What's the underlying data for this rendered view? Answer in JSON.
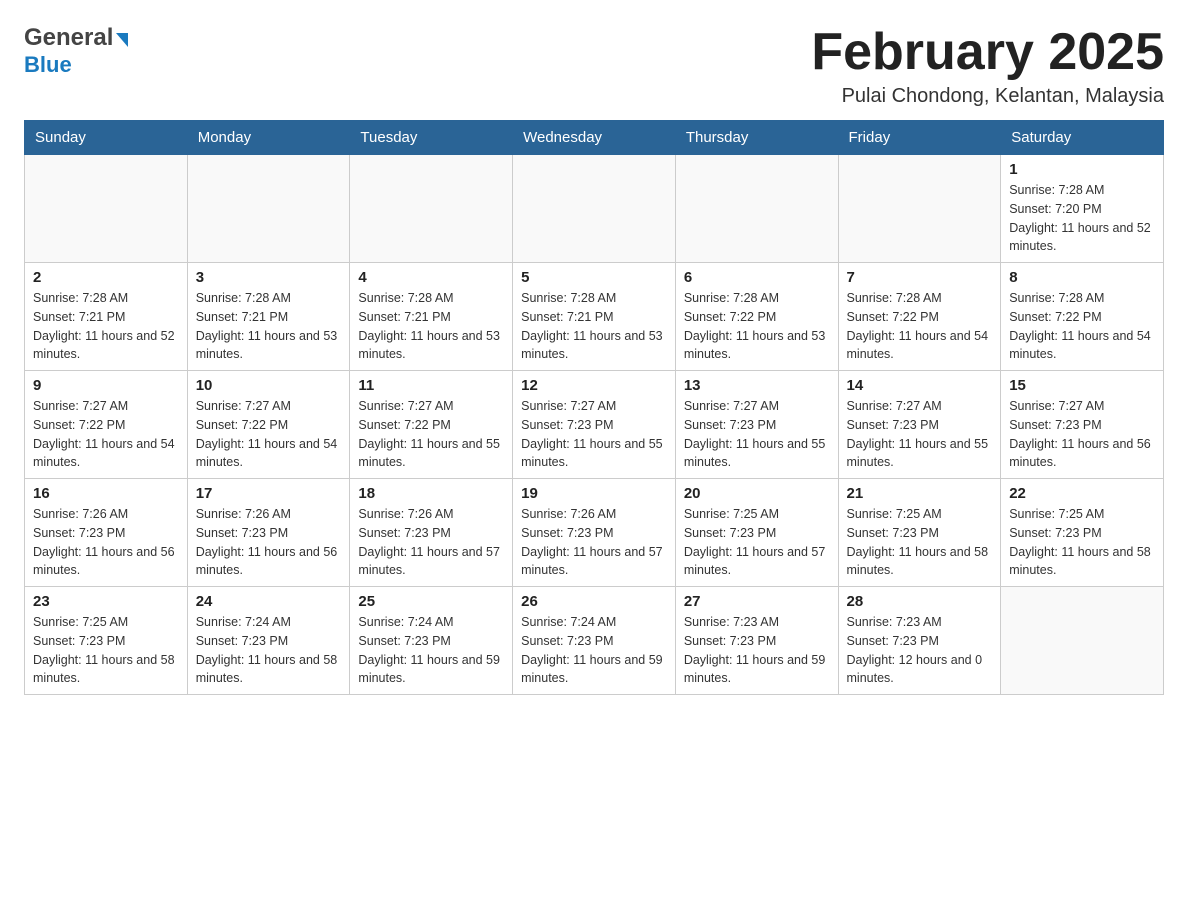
{
  "header": {
    "logo": {
      "part1": "General",
      "arrow": "▶",
      "part2": "Blue"
    },
    "title": "February 2025",
    "subtitle": "Pulai Chondong, Kelantan, Malaysia"
  },
  "weekdays": [
    "Sunday",
    "Monday",
    "Tuesday",
    "Wednesday",
    "Thursday",
    "Friday",
    "Saturday"
  ],
  "weeks": [
    [
      {
        "day": "",
        "info": ""
      },
      {
        "day": "",
        "info": ""
      },
      {
        "day": "",
        "info": ""
      },
      {
        "day": "",
        "info": ""
      },
      {
        "day": "",
        "info": ""
      },
      {
        "day": "",
        "info": ""
      },
      {
        "day": "1",
        "info": "Sunrise: 7:28 AM\nSunset: 7:20 PM\nDaylight: 11 hours and 52 minutes."
      }
    ],
    [
      {
        "day": "2",
        "info": "Sunrise: 7:28 AM\nSunset: 7:21 PM\nDaylight: 11 hours and 52 minutes."
      },
      {
        "day": "3",
        "info": "Sunrise: 7:28 AM\nSunset: 7:21 PM\nDaylight: 11 hours and 53 minutes."
      },
      {
        "day": "4",
        "info": "Sunrise: 7:28 AM\nSunset: 7:21 PM\nDaylight: 11 hours and 53 minutes."
      },
      {
        "day": "5",
        "info": "Sunrise: 7:28 AM\nSunset: 7:21 PM\nDaylight: 11 hours and 53 minutes."
      },
      {
        "day": "6",
        "info": "Sunrise: 7:28 AM\nSunset: 7:22 PM\nDaylight: 11 hours and 53 minutes."
      },
      {
        "day": "7",
        "info": "Sunrise: 7:28 AM\nSunset: 7:22 PM\nDaylight: 11 hours and 54 minutes."
      },
      {
        "day": "8",
        "info": "Sunrise: 7:28 AM\nSunset: 7:22 PM\nDaylight: 11 hours and 54 minutes."
      }
    ],
    [
      {
        "day": "9",
        "info": "Sunrise: 7:27 AM\nSunset: 7:22 PM\nDaylight: 11 hours and 54 minutes."
      },
      {
        "day": "10",
        "info": "Sunrise: 7:27 AM\nSunset: 7:22 PM\nDaylight: 11 hours and 54 minutes."
      },
      {
        "day": "11",
        "info": "Sunrise: 7:27 AM\nSunset: 7:22 PM\nDaylight: 11 hours and 55 minutes."
      },
      {
        "day": "12",
        "info": "Sunrise: 7:27 AM\nSunset: 7:23 PM\nDaylight: 11 hours and 55 minutes."
      },
      {
        "day": "13",
        "info": "Sunrise: 7:27 AM\nSunset: 7:23 PM\nDaylight: 11 hours and 55 minutes."
      },
      {
        "day": "14",
        "info": "Sunrise: 7:27 AM\nSunset: 7:23 PM\nDaylight: 11 hours and 55 minutes."
      },
      {
        "day": "15",
        "info": "Sunrise: 7:27 AM\nSunset: 7:23 PM\nDaylight: 11 hours and 56 minutes."
      }
    ],
    [
      {
        "day": "16",
        "info": "Sunrise: 7:26 AM\nSunset: 7:23 PM\nDaylight: 11 hours and 56 minutes."
      },
      {
        "day": "17",
        "info": "Sunrise: 7:26 AM\nSunset: 7:23 PM\nDaylight: 11 hours and 56 minutes."
      },
      {
        "day": "18",
        "info": "Sunrise: 7:26 AM\nSunset: 7:23 PM\nDaylight: 11 hours and 57 minutes."
      },
      {
        "day": "19",
        "info": "Sunrise: 7:26 AM\nSunset: 7:23 PM\nDaylight: 11 hours and 57 minutes."
      },
      {
        "day": "20",
        "info": "Sunrise: 7:25 AM\nSunset: 7:23 PM\nDaylight: 11 hours and 57 minutes."
      },
      {
        "day": "21",
        "info": "Sunrise: 7:25 AM\nSunset: 7:23 PM\nDaylight: 11 hours and 58 minutes."
      },
      {
        "day": "22",
        "info": "Sunrise: 7:25 AM\nSunset: 7:23 PM\nDaylight: 11 hours and 58 minutes."
      }
    ],
    [
      {
        "day": "23",
        "info": "Sunrise: 7:25 AM\nSunset: 7:23 PM\nDaylight: 11 hours and 58 minutes."
      },
      {
        "day": "24",
        "info": "Sunrise: 7:24 AM\nSunset: 7:23 PM\nDaylight: 11 hours and 58 minutes."
      },
      {
        "day": "25",
        "info": "Sunrise: 7:24 AM\nSunset: 7:23 PM\nDaylight: 11 hours and 59 minutes."
      },
      {
        "day": "26",
        "info": "Sunrise: 7:24 AM\nSunset: 7:23 PM\nDaylight: 11 hours and 59 minutes."
      },
      {
        "day": "27",
        "info": "Sunrise: 7:23 AM\nSunset: 7:23 PM\nDaylight: 11 hours and 59 minutes."
      },
      {
        "day": "28",
        "info": "Sunrise: 7:23 AM\nSunset: 7:23 PM\nDaylight: 12 hours and 0 minutes."
      },
      {
        "day": "",
        "info": ""
      }
    ]
  ]
}
